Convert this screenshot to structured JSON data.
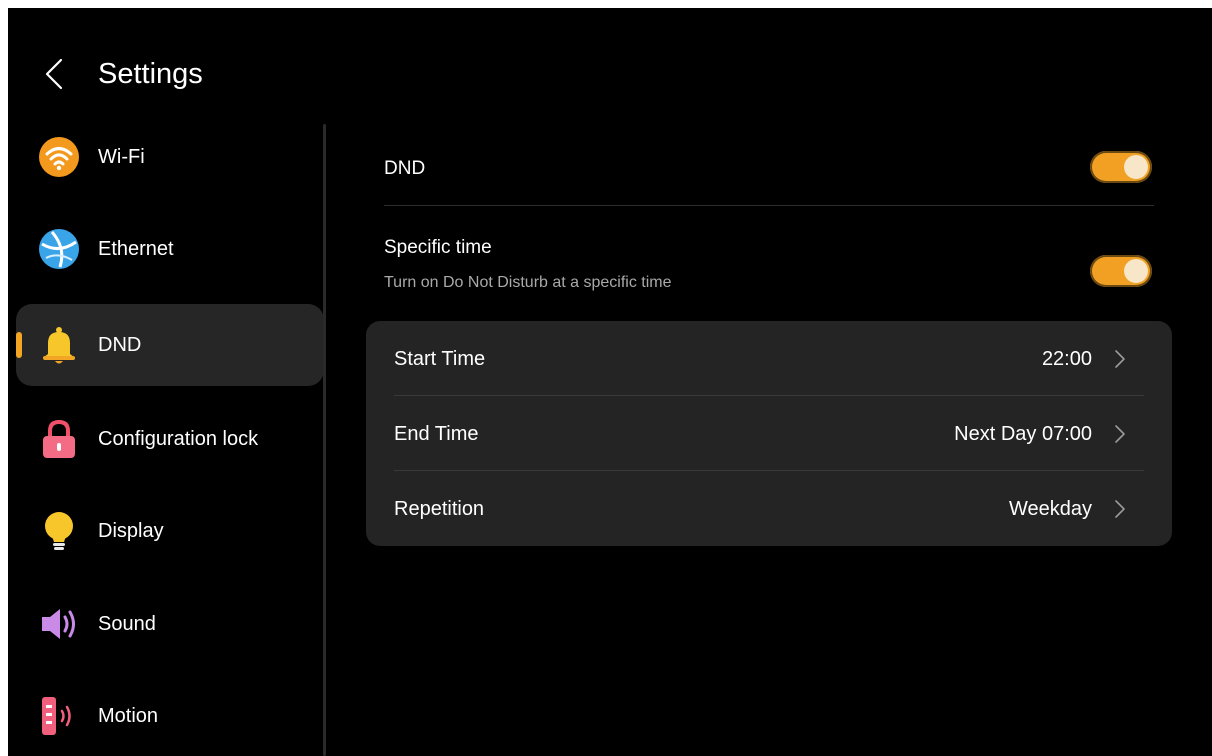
{
  "header": {
    "title": "Settings",
    "back_icon": "chevron-left-icon"
  },
  "sidebar": {
    "items": [
      {
        "label": "Wi-Fi",
        "icon": "wifi-icon",
        "active": false
      },
      {
        "label": "Ethernet",
        "icon": "globe-icon",
        "active": false
      },
      {
        "label": "DND",
        "icon": "bell-icon",
        "active": true
      },
      {
        "label": "Configuration lock",
        "icon": "lock-icon",
        "active": false
      },
      {
        "label": "Display",
        "icon": "lightbulb-icon",
        "active": false
      },
      {
        "label": "Sound",
        "icon": "speaker-icon",
        "active": false
      },
      {
        "label": "Motion",
        "icon": "motion-sensor-icon",
        "active": false
      }
    ]
  },
  "content": {
    "dnd": {
      "label": "DND",
      "enabled": true
    },
    "specific_time": {
      "label": "Specific time",
      "description": "Turn on Do Not Disturb at a specific time",
      "enabled": true
    },
    "schedule": [
      {
        "label": "Start Time",
        "value": "22:00"
      },
      {
        "label": "End Time",
        "value": "Next Day 07:00"
      },
      {
        "label": "Repetition",
        "value": "Weekday"
      }
    ]
  },
  "colors": {
    "accent": "#f2a023",
    "background": "#000000",
    "card": "#242424",
    "active_item": "#262626"
  }
}
